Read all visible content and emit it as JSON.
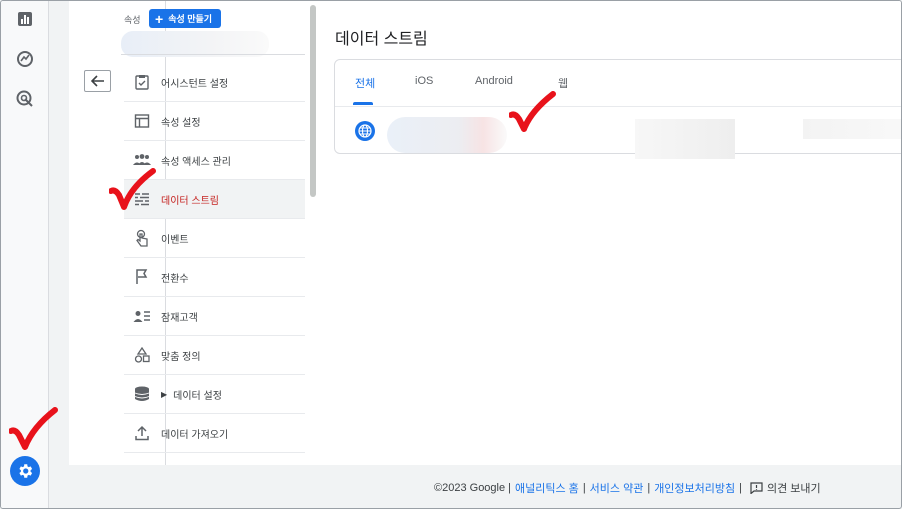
{
  "rail": {
    "items": [
      {
        "name": "reports-icon"
      },
      {
        "name": "explore-icon"
      },
      {
        "name": "advertising-icon"
      }
    ],
    "settings": {
      "name": "admin-gear-icon"
    }
  },
  "property": {
    "label": "속성",
    "create_button": "속성 만들기",
    "create_icon": "+"
  },
  "menu": {
    "items": [
      {
        "label": "어시스턴트 설정",
        "icon": "checklist-icon"
      },
      {
        "label": "속성 설정",
        "icon": "property-settings-icon"
      },
      {
        "label": "속성 액세스 관리",
        "icon": "people-icon"
      },
      {
        "label": "데이터 스트림",
        "icon": "data-stream-icon",
        "active": true
      },
      {
        "label": "이벤트",
        "icon": "touch-icon"
      },
      {
        "label": "전환수",
        "icon": "flag-icon"
      },
      {
        "label": "잠재고객",
        "icon": "audience-icon"
      },
      {
        "label": "맞춤 정의",
        "icon": "shapes-icon"
      },
      {
        "label": "데이터 설정",
        "icon": "database-icon",
        "expandable": true
      },
      {
        "label": "데이터 가져오기",
        "icon": "upload-icon"
      }
    ]
  },
  "content": {
    "title": "데이터 스트림",
    "tabs": [
      {
        "label": "전체",
        "active": true
      },
      {
        "label": "iOS"
      },
      {
        "label": "Android"
      },
      {
        "label": "웹"
      }
    ]
  },
  "footer": {
    "copyright": "©2023 Google |",
    "analytics_home": "애널리틱스 홈",
    "sep1": "|",
    "terms": "서비스 약관",
    "sep2": "|",
    "privacy": "개인정보처리방침",
    "sep3": "|",
    "feedback": "의견 보내기"
  },
  "colors": {
    "accent": "#1a73e8",
    "active_text": "#c5221f",
    "annotation": "#e8121b"
  }
}
